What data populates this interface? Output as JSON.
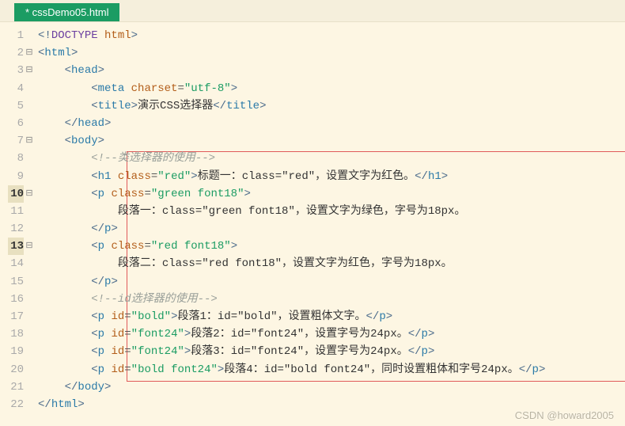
{
  "tab": {
    "label": "* cssDemo05.html"
  },
  "gutter": {
    "lines": [
      {
        "num": "1",
        "fold": "",
        "hl": false
      },
      {
        "num": "2",
        "fold": "⊟",
        "hl": false
      },
      {
        "num": "3",
        "fold": "⊟",
        "hl": false
      },
      {
        "num": "4",
        "fold": "",
        "hl": false
      },
      {
        "num": "5",
        "fold": "",
        "hl": false
      },
      {
        "num": "6",
        "fold": "",
        "hl": false
      },
      {
        "num": "7",
        "fold": "⊟",
        "hl": false
      },
      {
        "num": "8",
        "fold": "",
        "hl": false
      },
      {
        "num": "9",
        "fold": "",
        "hl": false
      },
      {
        "num": "10",
        "fold": "⊟",
        "hl": true
      },
      {
        "num": "11",
        "fold": "",
        "hl": false
      },
      {
        "num": "12",
        "fold": "",
        "hl": false
      },
      {
        "num": "13",
        "fold": "⊟",
        "hl": true
      },
      {
        "num": "14",
        "fold": "",
        "hl": false
      },
      {
        "num": "15",
        "fold": "",
        "hl": false
      },
      {
        "num": "16",
        "fold": "",
        "hl": false
      },
      {
        "num": "17",
        "fold": "",
        "hl": false
      },
      {
        "num": "18",
        "fold": "",
        "hl": false
      },
      {
        "num": "19",
        "fold": "",
        "hl": false
      },
      {
        "num": "20",
        "fold": "",
        "hl": false
      },
      {
        "num": "21",
        "fold": "",
        "hl": false
      },
      {
        "num": "22",
        "fold": "",
        "hl": false
      }
    ]
  },
  "code": {
    "ind1": "    ",
    "ind2": "        ",
    "ind3": "            ",
    "ind4": "                ",
    "lt": "<",
    "gt": ">",
    "lts": "</",
    "bang": "!",
    "kw_doctype": "DOCTYPE",
    "val_html": "html",
    "tag_html": "html",
    "tag_head": "head",
    "tag_meta": "meta",
    "tag_title": "title",
    "tag_body": "body",
    "tag_h1": "h1",
    "tag_p": "p",
    "attr_charset": "charset",
    "attr_class": "class",
    "attr_id": "id",
    "eq": "=",
    "q": "\"",
    "val_utf8": "utf-8",
    "title_text": "演示CSS选择器",
    "comment1": "<!--类选择器的使用-->",
    "comment2": "<!--id选择器的使用-->",
    "val_red": "red",
    "val_greenfont18": "green font18",
    "val_redfont18": "red font18",
    "val_bold": "bold",
    "val_font24": "font24",
    "val_boldfont24": "bold font24",
    "h1_text": "标题一：class=\"red\"，设置文字为红色。",
    "p1_text": "段落一：class=\"green font18\"，设置文字为绿色，字号为18px。",
    "p2_text": "段落二：class=\"red font18\"，设置文字为红色，字号为18px。",
    "p3_text": "段落1：id=\"bold\"，设置粗体文字。",
    "p4_text": "段落2：id=\"font24\"，设置字号为24px。",
    "p5_text": "段落3：id=\"font24\"，设置字号为24px。",
    "p6_text": "段落4：id=\"bold font24\"，同时设置粗体和字号24px。"
  },
  "watermark": "CSDN @howard2005"
}
